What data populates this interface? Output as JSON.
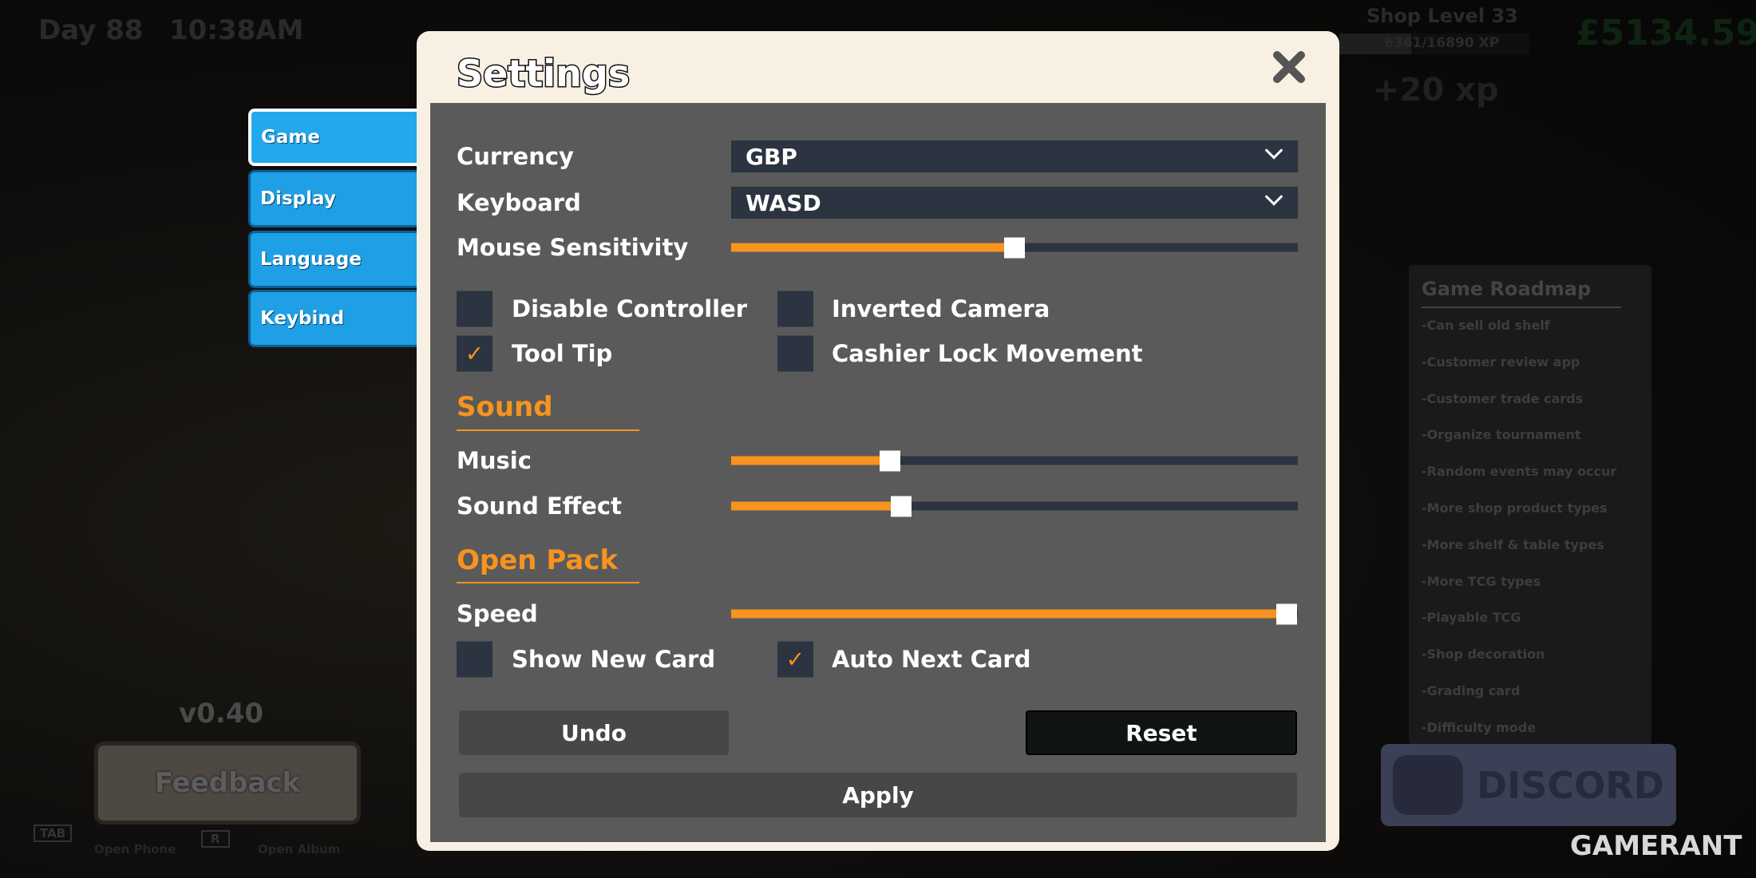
{
  "hud": {
    "day": "Day 88",
    "time": "10:38AM",
    "shop_level": "Shop Level 33",
    "xp": "6361/16890 XP",
    "xp_progress": 0.377,
    "money": "£5134.59",
    "xp_gain": "+20 xp",
    "version": "v0.40",
    "feedback": "Feedback",
    "hints": [
      {
        "key": "TAB",
        "label": "Open Phone"
      },
      {
        "key": "R",
        "label": "Open Album"
      }
    ],
    "discord": "DISCORD",
    "watermark": "GAMERANT"
  },
  "roadmap": {
    "title": "Game Roadmap",
    "items": [
      "-Can sell old shelf",
      "-Customer review app",
      "-Customer trade cards",
      "-Organize tournament",
      "-Random events may occur",
      "-More shop product types",
      "-More shelf & table types",
      "-More TCG types",
      "-Playable TCG",
      "-Shop decoration",
      "-Grading card",
      "-Difficulty mode"
    ]
  },
  "tabs": [
    {
      "label": "Game",
      "active": true
    },
    {
      "label": "Display"
    },
    {
      "label": "Language"
    },
    {
      "label": "Keybind"
    }
  ],
  "settings": {
    "title": "Settings",
    "currency": {
      "label": "Currency",
      "value": "GBP"
    },
    "keyboard": {
      "label": "Keyboard",
      "value": "WASD"
    },
    "mouse_sensitivity": {
      "label": "Mouse Sensitivity",
      "value": 0.5
    },
    "disable_controller": {
      "label": "Disable Controller",
      "checked": false
    },
    "inverted_camera": {
      "label": "Inverted Camera",
      "checked": false
    },
    "tool_tip": {
      "label": "Tool Tip",
      "checked": true
    },
    "cashier_lock": {
      "label": "Cashier Lock Movement",
      "checked": false
    },
    "sound": {
      "title": "Sound",
      "music": {
        "label": "Music",
        "value": 0.28
      },
      "sfx": {
        "label": "Sound Effect",
        "value": 0.3
      }
    },
    "open_pack": {
      "title": "Open Pack",
      "speed": {
        "label": "Speed",
        "value": 0.98
      },
      "show_new_card": {
        "label": "Show New Card",
        "checked": false
      },
      "auto_next_card": {
        "label": "Auto Next Card",
        "checked": true
      }
    },
    "undo": "Undo",
    "reset": "Reset",
    "apply": "Apply"
  },
  "colors": {
    "accent": "#f7931e",
    "tab": "#1e9fe6",
    "panel": "#5a5a5a",
    "control": "#2b3440",
    "frame": "#f8f1e3"
  }
}
